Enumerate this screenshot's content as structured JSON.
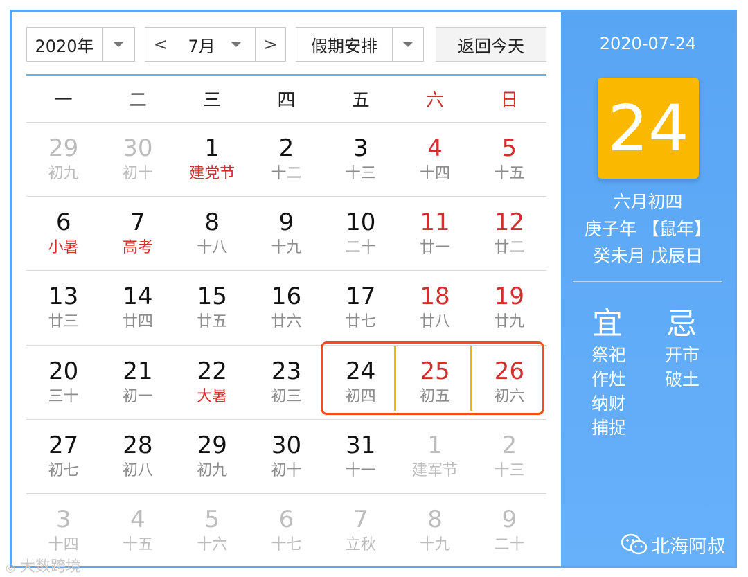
{
  "toolbar": {
    "year": "2020年",
    "prev": "<",
    "month": "7月",
    "next": ">",
    "holiday": "假期安排",
    "today": "返回今天"
  },
  "weekdays": [
    {
      "label": "一",
      "red": false
    },
    {
      "label": "二",
      "red": false
    },
    {
      "label": "三",
      "red": false
    },
    {
      "label": "四",
      "red": false
    },
    {
      "label": "五",
      "red": false
    },
    {
      "label": "六",
      "red": true
    },
    {
      "label": "日",
      "red": true
    }
  ],
  "weeks": [
    [
      {
        "d": "29",
        "l": "初九",
        "out": true
      },
      {
        "d": "30",
        "l": "初十",
        "out": true
      },
      {
        "d": "1",
        "l": "建党节",
        "fest": true
      },
      {
        "d": "2",
        "l": "十二"
      },
      {
        "d": "3",
        "l": "十三"
      },
      {
        "d": "4",
        "l": "十四",
        "red": true
      },
      {
        "d": "5",
        "l": "十五",
        "red": true
      }
    ],
    [
      {
        "d": "6",
        "l": "小暑",
        "fest": true
      },
      {
        "d": "7",
        "l": "高考",
        "fest": true
      },
      {
        "d": "8",
        "l": "十八"
      },
      {
        "d": "9",
        "l": "十九"
      },
      {
        "d": "10",
        "l": "二十"
      },
      {
        "d": "11",
        "l": "廿一",
        "red": true
      },
      {
        "d": "12",
        "l": "廿二",
        "red": true
      }
    ],
    [
      {
        "d": "13",
        "l": "廿三"
      },
      {
        "d": "14",
        "l": "廿四"
      },
      {
        "d": "15",
        "l": "廿五"
      },
      {
        "d": "16",
        "l": "廿六"
      },
      {
        "d": "17",
        "l": "廿七"
      },
      {
        "d": "18",
        "l": "廿八",
        "red": true
      },
      {
        "d": "19",
        "l": "廿九",
        "red": true
      }
    ],
    [
      {
        "d": "20",
        "l": "三十"
      },
      {
        "d": "21",
        "l": "初一"
      },
      {
        "d": "22",
        "l": "大暑",
        "fest": true
      },
      {
        "d": "23",
        "l": "初三"
      },
      {
        "d": "24",
        "l": "初四"
      },
      {
        "d": "25",
        "l": "初五",
        "red": true
      },
      {
        "d": "26",
        "l": "初六",
        "red": true
      }
    ],
    [
      {
        "d": "27",
        "l": "初七"
      },
      {
        "d": "28",
        "l": "初八"
      },
      {
        "d": "29",
        "l": "初九"
      },
      {
        "d": "30",
        "l": "初十"
      },
      {
        "d": "31",
        "l": "十一"
      },
      {
        "d": "1",
        "l": "建军节",
        "out": true
      },
      {
        "d": "2",
        "l": "十三",
        "out": true
      }
    ],
    [
      {
        "d": "3",
        "l": "十四",
        "out": true
      },
      {
        "d": "4",
        "l": "十五",
        "out": true
      },
      {
        "d": "5",
        "l": "十六",
        "out": true
      },
      {
        "d": "6",
        "l": "十七",
        "out": true
      },
      {
        "d": "7",
        "l": "立秋",
        "out": true
      },
      {
        "d": "8",
        "l": "十九",
        "out": true
      },
      {
        "d": "9",
        "l": "二十",
        "out": true
      }
    ]
  ],
  "side": {
    "date": "2020-07-24",
    "day": "24",
    "lunar_date": "六月初四",
    "year_line": "庚子年 【鼠年】",
    "month_day_line": "癸未月 戊辰日",
    "yi_label": "宜",
    "ji_label": "忌",
    "yi_items": [
      "祭祀",
      "作灶",
      "纳财",
      "捕捉"
    ],
    "ji_items": [
      "开市",
      "破土"
    ]
  },
  "watermarks": {
    "right": "北海阿叔",
    "left": "大数跨境"
  },
  "colors": {
    "accent_blue": "#5ea7f0",
    "highlight_orange": "#ff4a14",
    "today_yellow": "#fbb800",
    "weekend_red": "#d22f2f"
  }
}
